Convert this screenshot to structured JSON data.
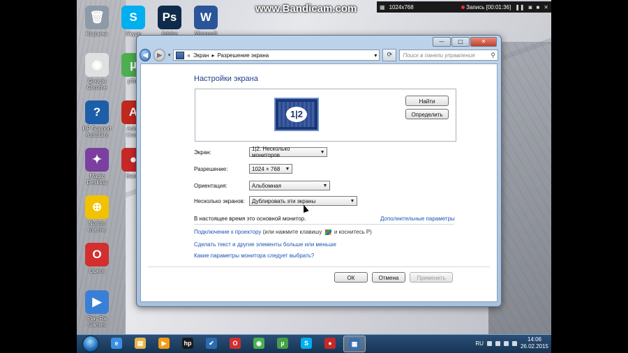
{
  "overlay": {
    "watermark": "www.Bandicam.com",
    "resolution": "1024x768",
    "record_label": "Запись [00:01:36]"
  },
  "desktop_icons": [
    {
      "label": "Корзина",
      "color": "#8e9aa6",
      "glyph": "🗑"
    },
    {
      "label": "Skype",
      "color": "#00aff0",
      "glyph": "S"
    },
    {
      "label": "Adobe",
      "color": "#0f2a4a",
      "glyph": "Ps"
    },
    {
      "label": "Microsoft",
      "color": "#2a5699",
      "glyph": "W"
    },
    {
      "label": "Google\nChrome",
      "color": "#e0e0e0",
      "glyph": "◉"
    },
    {
      "label": "pTor",
      "color": "#4caf50",
      "glyph": "µ"
    },
    {
      "label": "HP Support\nAssistant",
      "color": "#1c5fa8",
      "glyph": "?"
    },
    {
      "label": "Adob\nCreat",
      "color": "#c0281e",
      "glyph": "A"
    },
    {
      "label": "Magic\nDesktop",
      "color": "#7b3fa0",
      "glyph": "✦"
    },
    {
      "label": "Bandi",
      "color": "#c62828",
      "glyph": "●"
    },
    {
      "label": "Norton\nInterne",
      "color": "#f2c200",
      "glyph": "⊕"
    },
    {
      "label": "Opera",
      "color": "#d32f2f",
      "glyph": "O"
    },
    {
      "label": "Play Ra\nGames",
      "color": "#3a7fd6",
      "glyph": "▶"
    }
  ],
  "window": {
    "controls": {
      "minimize": "—",
      "maximize": "□",
      "close": "✕"
    },
    "breadcrumb": [
      "Экран",
      "Разрешение экрана"
    ],
    "search_placeholder": "Поиск в панели управления",
    "title": "Настройки экрана",
    "monitor_label": "1|2",
    "detect_button": "Найти",
    "identify_button": "Определить",
    "fields": {
      "display": {
        "label": "Экран:",
        "value": "1|2. Несколько мониторов"
      },
      "resolution": {
        "label": "Разрешение:",
        "value": "1024 × 768"
      },
      "orientation": {
        "label": "Ориентация:",
        "value": "Альбомная"
      },
      "multiple": {
        "label": "Несколько экранов:",
        "value": "Дублировать эти экраны"
      }
    },
    "status_text": "В настоящее время это основной монитор.",
    "advanced_link": "Дополнительные параметры",
    "projector_link": "Подключение к проектору",
    "projector_hint_a": "(или нажмите клавишу",
    "projector_hint_b": "и коснитесь P)",
    "text_size_link": "Сделать текст и другие элементы больше или меньше",
    "monitor_choice_link": "Какие параметры монитора следует выбрать?",
    "ok_button": "ОК",
    "cancel_button": "Отмена",
    "apply_button": "Применить"
  },
  "taskbar": {
    "language": "RU",
    "time": "14:06",
    "date": "26.02.2015",
    "apps": [
      {
        "name": "ie",
        "color": "#3b8fe0",
        "glyph": "e"
      },
      {
        "name": "explorer",
        "color": "#e6b64a",
        "glyph": "▤"
      },
      {
        "name": "media",
        "color": "#f39c12",
        "glyph": "▶"
      },
      {
        "name": "hp",
        "color": "#1a1a1a",
        "glyph": "hp"
      },
      {
        "name": "check",
        "color": "#2b6cb0",
        "glyph": "✔"
      },
      {
        "name": "opera",
        "color": "#d32f2f",
        "glyph": "O"
      },
      {
        "name": "chrome",
        "color": "#4caf50",
        "glyph": "◉"
      },
      {
        "name": "utorrent",
        "color": "#43a047",
        "glyph": "µ"
      },
      {
        "name": "skype",
        "color": "#00aff0",
        "glyph": "S"
      },
      {
        "name": "bandicam",
        "color": "#c62828",
        "glyph": "●"
      },
      {
        "name": "control-panel",
        "color": "#3c6fb0",
        "glyph": "▦"
      }
    ]
  }
}
